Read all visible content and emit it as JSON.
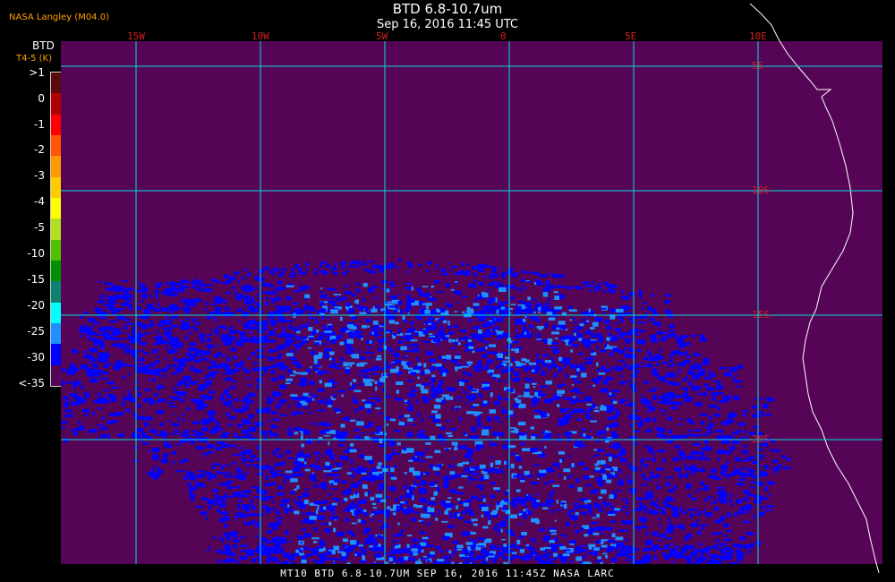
{
  "header": {
    "title": "BTD 6.8-10.7um",
    "timestamp": "Sep 16, 2016 11:45 UTC",
    "credit": "NASA Langley (M04.0)"
  },
  "legend": {
    "label": "BTD",
    "units": "T4-5 (K)",
    "ticks": [
      ">1",
      "0",
      "-1",
      "-2",
      "-3",
      "-4",
      "-5",
      "-10",
      "-15",
      "-20",
      "-25",
      "-30",
      "<-35"
    ],
    "colors": [
      "#5a0a0a",
      "#b00000",
      "#ff0000",
      "#ff5500",
      "#ff9900",
      "#ffcc00",
      "#ffff00",
      "#b0e020",
      "#50c000",
      "#009000",
      "#108070",
      "#00ffff",
      "#1e90ff",
      "#0000ff",
      "#560556"
    ]
  },
  "map": {
    "lon_labels": [
      "15W",
      "10W",
      "5W",
      "0",
      "5E",
      "10E"
    ],
    "lat_labels": [
      "5S",
      "10S",
      "15S",
      "20S"
    ],
    "background_color": "#560556",
    "grid_color": "#00e0e0",
    "coast_color": "#ffffff"
  },
  "footer": {
    "text": "MT10  BTD 6.8-10.7UM  SEP 16, 2016 11:45Z  NASA LARC"
  }
}
